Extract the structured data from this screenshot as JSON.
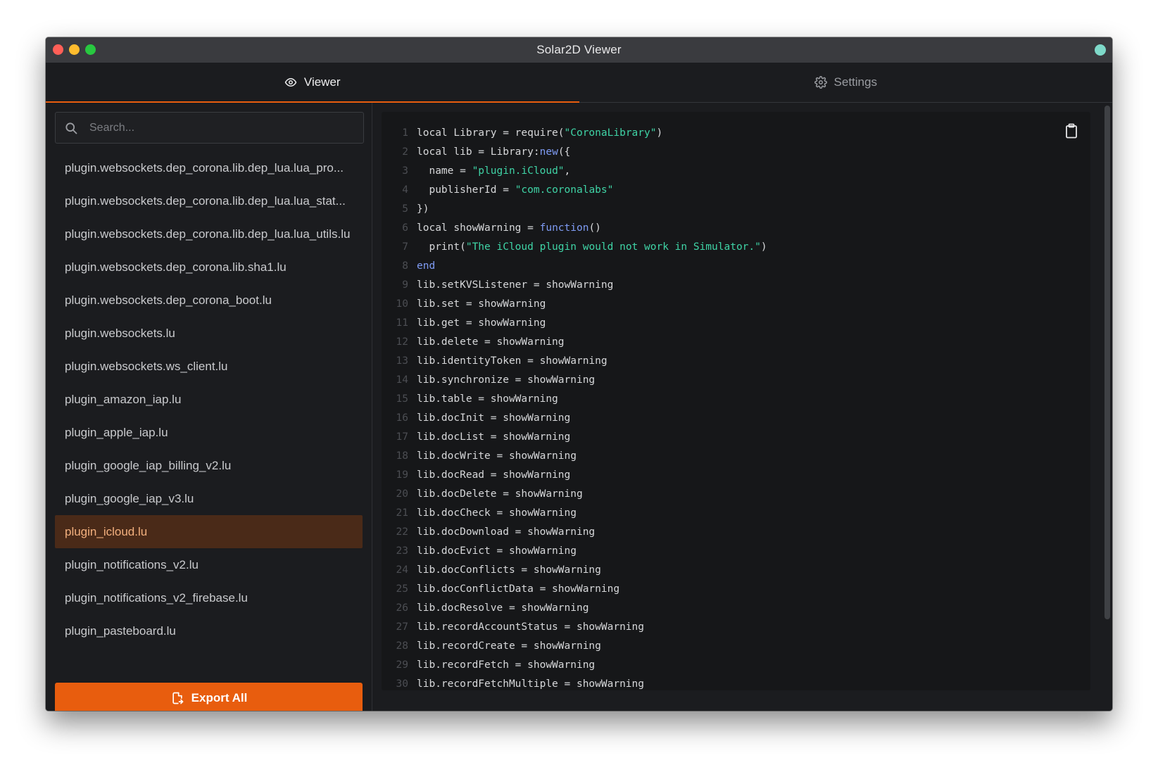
{
  "window": {
    "title": "Solar2D Viewer"
  },
  "tabs": [
    {
      "label": "Viewer",
      "icon": "eye-icon",
      "active": true
    },
    {
      "label": "Settings",
      "icon": "gear-icon",
      "active": false
    }
  ],
  "search": {
    "placeholder": "Search..."
  },
  "files": [
    "plugin.websockets.dep_corona.lib.dep_lua.lua_pro...",
    "plugin.websockets.dep_corona.lib.dep_lua.lua_stat...",
    "plugin.websockets.dep_corona.lib.dep_lua.lua_utils.lu",
    "plugin.websockets.dep_corona.lib.sha1.lu",
    "plugin.websockets.dep_corona_boot.lu",
    "plugin.websockets.lu",
    "plugin.websockets.ws_client.lu",
    "plugin_amazon_iap.lu",
    "plugin_apple_iap.lu",
    "plugin_google_iap_billing_v2.lu",
    "plugin_google_iap_v3.lu",
    "plugin_icloud.lu",
    "plugin_notifications_v2.lu",
    "plugin_notifications_v2_firebase.lu",
    "plugin_pasteboard.lu"
  ],
  "selected_file": "plugin_icloud.lu",
  "export_button": {
    "label": "Export All",
    "icon": "export-file-icon"
  },
  "code_lines": [
    [
      {
        "t": "local Library = require("
      },
      {
        "s": "\"CoronaLibrary\""
      },
      {
        "t": ")"
      }
    ],
    [
      {
        "t": "local lib = Library:"
      },
      {
        "k": "new"
      },
      {
        "t": "({"
      }
    ],
    [
      {
        "t": "  name = "
      },
      {
        "s": "\"plugin.iCloud\""
      },
      {
        "t": ","
      }
    ],
    [
      {
        "t": "  publisherId = "
      },
      {
        "s": "\"com.coronalabs\""
      }
    ],
    [
      {
        "t": "})"
      }
    ],
    [
      {
        "t": "local showWarning = "
      },
      {
        "k": "function"
      },
      {
        "t": "()"
      }
    ],
    [
      {
        "t": "  print("
      },
      {
        "s": "\"The iCloud plugin would not work in Simulator.\""
      },
      {
        "t": ")"
      }
    ],
    [
      {
        "k": "end"
      }
    ],
    [
      {
        "t": "lib.setKVSListener = showWarning"
      }
    ],
    [
      {
        "t": "lib.set = showWarning"
      }
    ],
    [
      {
        "t": "lib.get = showWarning"
      }
    ],
    [
      {
        "t": "lib.delete = showWarning"
      }
    ],
    [
      {
        "t": "lib.identityToken = showWarning"
      }
    ],
    [
      {
        "t": "lib.synchronize = showWarning"
      }
    ],
    [
      {
        "t": "lib.table = showWarning"
      }
    ],
    [
      {
        "t": "lib.docInit = showWarning"
      }
    ],
    [
      {
        "t": "lib.docList = showWarning"
      }
    ],
    [
      {
        "t": "lib.docWrite = showWarning"
      }
    ],
    [
      {
        "t": "lib.docRead = showWarning"
      }
    ],
    [
      {
        "t": "lib.docDelete = showWarning"
      }
    ],
    [
      {
        "t": "lib.docCheck = showWarning"
      }
    ],
    [
      {
        "t": "lib.docDownload = showWarning"
      }
    ],
    [
      {
        "t": "lib.docEvict = showWarning"
      }
    ],
    [
      {
        "t": "lib.docConflicts = showWarning"
      }
    ],
    [
      {
        "t": "lib.docConflictData = showWarning"
      }
    ],
    [
      {
        "t": "lib.docResolve = showWarning"
      }
    ],
    [
      {
        "t": "lib.recordAccountStatus = showWarning"
      }
    ],
    [
      {
        "t": "lib.recordCreate = showWarning"
      }
    ],
    [
      {
        "t": "lib.recordFetch = showWarning"
      }
    ],
    [
      {
        "t": "lib.recordFetchMultiple = showWarning"
      }
    ]
  ],
  "colors": {
    "accent": "#e85d0e",
    "string": "#3fd4a6",
    "keyword": "#7f9cf5",
    "selected_bg": "#4a2a18",
    "selected_text": "#f3b07e"
  }
}
